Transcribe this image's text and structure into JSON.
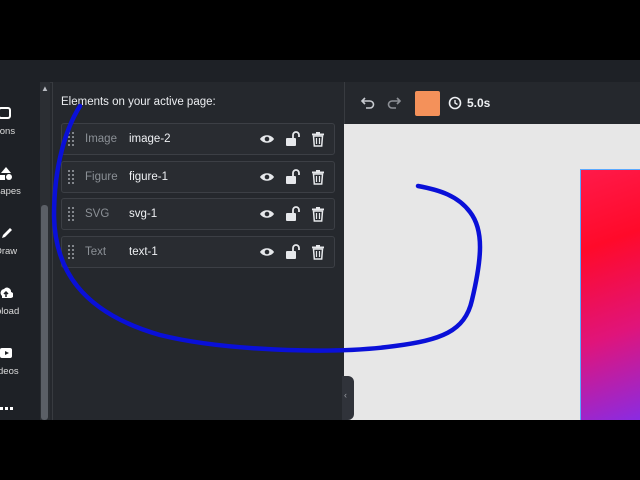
{
  "sidebar": {
    "items": [
      {
        "label": "cons",
        "icon": "icons-icon"
      },
      {
        "label": "hapes",
        "icon": "shapes-icon"
      },
      {
        "label": "Draw",
        "icon": "draw-icon"
      },
      {
        "label": "pload",
        "icon": "upload-icon"
      },
      {
        "label": "deos",
        "icon": "videos-icon"
      },
      {
        "label": "",
        "icon": "grid-icon"
      }
    ]
  },
  "panel": {
    "title": "Elements on your active page:",
    "layers": [
      {
        "type": "Image",
        "name": "image-2"
      },
      {
        "type": "Figure",
        "name": "figure-1"
      },
      {
        "type": "SVG",
        "name": "svg-1"
      },
      {
        "type": "Text",
        "name": "text-1"
      }
    ]
  },
  "toolbar": {
    "duration": "5.0s",
    "swatch_color": "#f4915a"
  },
  "annotation": {
    "color": "#0a10d8"
  }
}
